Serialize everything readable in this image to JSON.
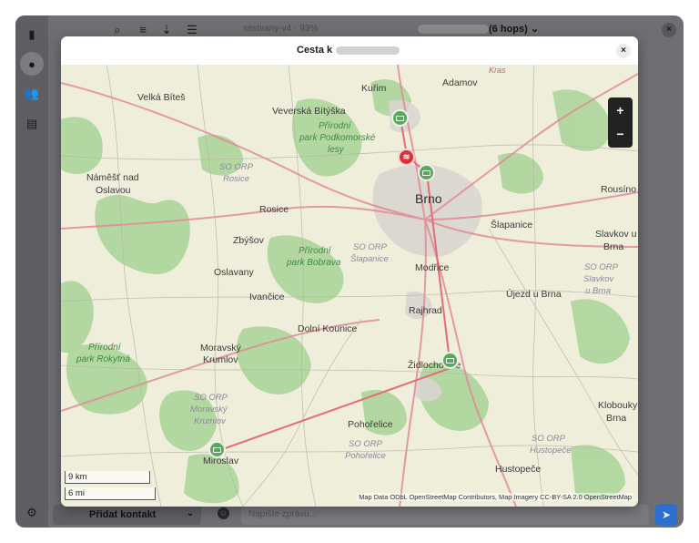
{
  "header": {
    "subtitle": "sestvany-v4 · 93%",
    "hops": "(6 hops)",
    "chevron": "⌄",
    "close": "×"
  },
  "composer": {
    "add_contact": "Přidat kontakt",
    "placeholder": "Napište zprávu..."
  },
  "modal": {
    "title": "Cesta k",
    "close": "×"
  },
  "map": {
    "zoom_in": "+",
    "zoom_out": "−",
    "scale_km": "9 km",
    "scale_mi": "6 mi",
    "attribution": "Map Data ODbL OpenStreetMap Contributors, Map Imagery CC-BY-SA 2.0 OpenStreetMap",
    "labels": {
      "krasa": "Kras",
      "kurim": "Kuřim",
      "adamov": "Adamov",
      "velka_bites": "Velká Bíteš",
      "veverska": "Veverská Bítýška",
      "park1a": "Přírodní",
      "park1b": "park Podkomorské",
      "park1c": "lesy",
      "namest1": "Náměšť nad",
      "namest2": "Oslavou",
      "orp_rosice1": "SO ORP",
      "orp_rosice2": "Rosice",
      "brno": "Brno",
      "rousinov": "Rousíno",
      "rosice": "Rosice",
      "slapanice": "Šlapanice",
      "slavkov1": "Slavkov u",
      "slavkov2": "Brna",
      "zbysov": "Zbýšov",
      "park2a": "Přírodní",
      "park2b": "park Bobrava",
      "orp_slap1": "SO ORP",
      "orp_slap2": "Šlapanice",
      "modrice": "Modřice",
      "oslavany": "Oslavany",
      "orp_slav1": "SO ORP",
      "orp_slav2": "Slavkov",
      "orp_slav3": "u Brna",
      "ivancice": "Ivančice",
      "ujezd": "Újezd u Brna",
      "rajhrad": "Rajhrad",
      "dolni": "Dolní Kounice",
      "moravsky1": "Moravský",
      "moravsky2": "Krumlov",
      "park3a": "Přírodní",
      "park3b": "park Rokytná",
      "zidlochovice": "Židlochovice",
      "orp_mk1": "SO ORP",
      "orp_mk2": "Moravský",
      "orp_mk3": "Krumlov",
      "klobouky1": "Klobouky u",
      "klobouky2": "Brna",
      "orp_hus1": "SO ORP",
      "orp_hus2": "Hustopeče",
      "pohorelice": "Pohořelice",
      "orp_poh1": "SO ORP",
      "orp_poh2": "Pohořelice",
      "miroslav": "Miroslav",
      "hustopece": "Hustopeče"
    }
  },
  "icons": [
    "sim-card-icon",
    "person-icon",
    "group-icon",
    "map-icon",
    "settings-icon",
    "search-icon",
    "filter-icon",
    "sort-icon",
    "menu-icon",
    "emoji-icon",
    "send-icon",
    "router-icon",
    "wifi-icon"
  ],
  "colors": {
    "accent": "#2c6fd1",
    "route": "#e0707a",
    "node": "#5aa860",
    "node_self": "#d8323a"
  }
}
